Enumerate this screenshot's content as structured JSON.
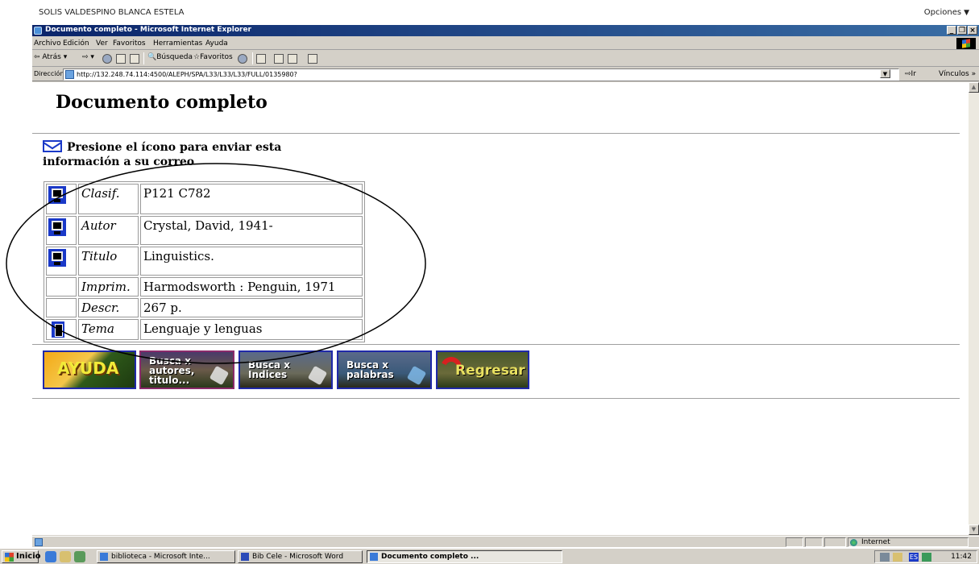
{
  "user_bar": {
    "username": "SOLIS VALDESPINO BLANCA ESTELA",
    "options_label": "Opciones"
  },
  "window": {
    "title": "Documento completo - Microsoft Internet Explorer"
  },
  "menu": [
    "Archivo",
    "Edición",
    "Ver",
    "Favoritos",
    "Herramientas",
    "Ayuda"
  ],
  "toolbar": {
    "back_label": "Atrás",
    "search_label": "Búsqueda",
    "favorites_label": "Favoritos"
  },
  "address": {
    "label": "Dirección",
    "url": "http://132.248.74.114:4500/ALEPH/SPA/L33/L33/L33/FULL/0135980?",
    "go_label": "Ir",
    "links_label": "Vínculos"
  },
  "page": {
    "title": "Documento completo",
    "mail_instruction": "Presione el ícono para enviar esta información a su correo",
    "record": [
      {
        "field": "Clasif.",
        "value": "P121 C782",
        "icon": "computer-icon"
      },
      {
        "field": "Autor",
        "value": "Crystal, David, 1941-",
        "icon": "computer-icon"
      },
      {
        "field": "Titulo",
        "value": "Linguistics.",
        "icon": "computer-icon"
      },
      {
        "field": "Imprim.",
        "value": "Harmodsworth : Penguin, 1971",
        "icon": ""
      },
      {
        "field": "Descr.",
        "value": "267 p.",
        "icon": ""
      },
      {
        "field": "Tema",
        "value": "Lenguaje y lenguas",
        "icon": "book-icon"
      }
    ],
    "buttons": {
      "ayuda": "AYUDA",
      "autores": "Busca x\nautores,\ntitulo...",
      "indices": "Busca x\nIndices",
      "palabras": "Busca x\npalabras",
      "regresar": "Regresar"
    }
  },
  "status": {
    "zone": "Internet"
  },
  "taskbar": {
    "start_label": "Inicio",
    "tasks": [
      "biblioteca - Microsoft Inte...",
      "Bib Cele - Microsoft Word",
      "Documento completo ..."
    ],
    "language": "ES",
    "clock": "11:42"
  }
}
